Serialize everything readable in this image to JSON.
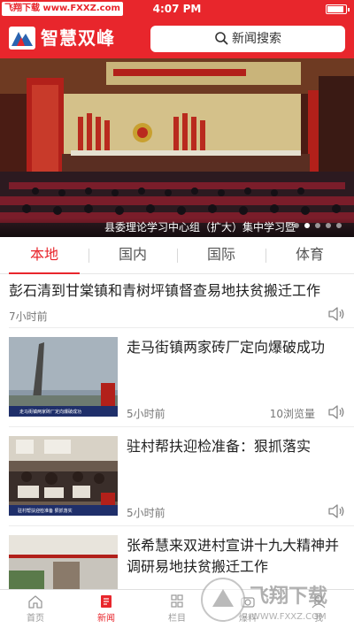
{
  "status_bar": {
    "carrier": "飞翔下载 www.FXXZ.com",
    "time": "4:07 PM",
    "battery_level": 0.9
  },
  "header": {
    "app_title": "智慧双峰",
    "search_placeholder": "新闻搜索"
  },
  "banner": {
    "caption": "县委理论学习中心组（扩大）集中学习暨",
    "slide_count": 5,
    "active_slide": 1
  },
  "tabs": [
    {
      "label": "本地",
      "active": true
    },
    {
      "label": "国内",
      "active": false
    },
    {
      "label": "国际",
      "active": false
    },
    {
      "label": "体育",
      "active": false
    }
  ],
  "news": [
    {
      "title": "彭石清到甘棠镇和青树坪镇督查易地扶贫搬迁工作",
      "time": "7小时前",
      "views": "",
      "has_image": false
    },
    {
      "title": "走马街镇两家砖厂定向爆破成功",
      "time": "5小时前",
      "views": "10浏览量",
      "has_image": true,
      "thumb_caption": "走马街镇两家砖厂定向爆破成功"
    },
    {
      "title": "驻村帮扶迎检准备：狠抓落实",
      "time": "5小时前",
      "views": "",
      "has_image": true,
      "thumb_caption": "驻村帮扶迎检准备 狠抓落实"
    },
    {
      "title": "张希慧来双进村宣讲十九大精神并调研易地扶贫搬迁工作",
      "time": "",
      "views": "",
      "has_image": true
    }
  ],
  "bottom_nav": [
    {
      "label": "首页",
      "icon": "home-icon",
      "active": false
    },
    {
      "label": "新闻",
      "icon": "news-icon",
      "active": true
    },
    {
      "label": "栏目",
      "icon": "grid-icon",
      "active": false
    },
    {
      "label": "爆料",
      "icon": "camera-icon",
      "active": false
    },
    {
      "label": "我",
      "icon": "user-icon",
      "active": false
    }
  ],
  "watermark": {
    "brand": "飞翔下载",
    "url": "WWW.FXXZ.COM"
  },
  "colors": {
    "accent": "#e8262c",
    "text": "#222222",
    "muted": "#777777"
  }
}
